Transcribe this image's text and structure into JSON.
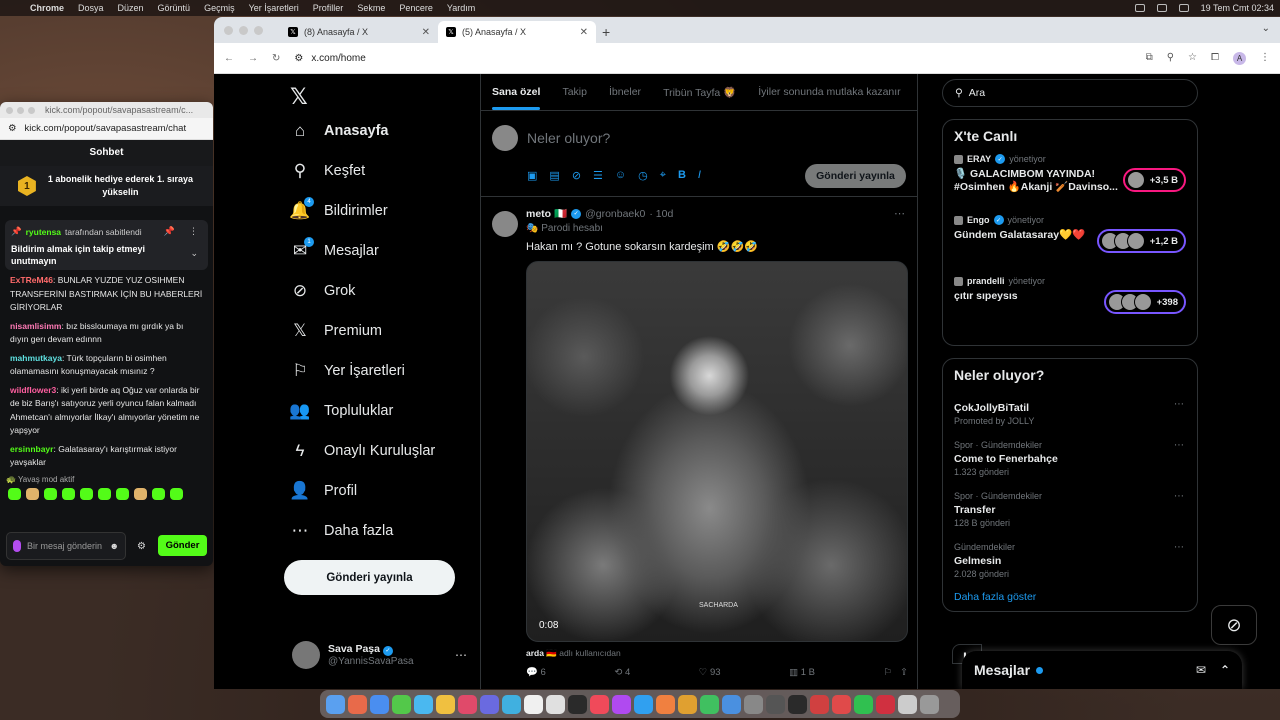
{
  "menubar": {
    "app": "Chrome",
    "items": [
      "Dosya",
      "Düzen",
      "Görüntü",
      "Geçmiş",
      "Yer İşaretleri",
      "Profiller",
      "Sekme",
      "Pencere",
      "Yardım"
    ],
    "clock": "19 Tem Cmt  02:34"
  },
  "browser": {
    "tabs": [
      {
        "title": "(8) Anasayfa / X"
      },
      {
        "title": "(5) Anasayfa / X"
      }
    ],
    "url": "x.com/home",
    "profile_initial": "A"
  },
  "x": {
    "nav": [
      {
        "label": "Anasayfa",
        "icon": "home-icon",
        "glyph": "⌂",
        "bold": true
      },
      {
        "label": "Keşfet",
        "icon": "search-icon",
        "glyph": "⚲"
      },
      {
        "label": "Bildirimler",
        "icon": "bell-icon",
        "glyph": "🔔",
        "badge": "4"
      },
      {
        "label": "Mesajlar",
        "icon": "mail-icon",
        "glyph": "✉",
        "badge": "1"
      },
      {
        "label": "Grok",
        "icon": "grok-icon",
        "glyph": "⊘"
      },
      {
        "label": "Premium",
        "icon": "x-premium-icon",
        "glyph": "𝕏"
      },
      {
        "label": "Yer İşaretleri",
        "icon": "bookmark-icon",
        "glyph": "⚐"
      },
      {
        "label": "Topluluklar",
        "icon": "communities-icon",
        "glyph": "👥"
      },
      {
        "label": "Onaylı Kuruluşlar",
        "icon": "lightning-icon",
        "glyph": "ϟ"
      },
      {
        "label": "Profil",
        "icon": "profile-icon",
        "glyph": "👤"
      },
      {
        "label": "Daha fazla",
        "icon": "more-circle-icon",
        "glyph": "⋯"
      }
    ],
    "post_button": "Gönderi yayınla",
    "me": {
      "name": "Sava Paşa",
      "handle": "@YannisSavaPasa"
    },
    "timeline_tabs": [
      "Sana özel",
      "Takip",
      "İbneler",
      "Tribün Tayfa 🦁",
      "İyiler sonunda mutlaka kazanır"
    ],
    "compose": {
      "placeholder": "Neler oluyor?",
      "send": "Gönderi yayınla"
    },
    "tweet": {
      "name": "meto 🇮🇹",
      "handle": "@gronbaek0",
      "time": "· 10d",
      "parody": "Parodi hesabı",
      "text": "Hakan mı ? Gotune sokarsın kardeşim 🤣🤣🤣",
      "video_time": "0:08",
      "watermark": "SACHARDA",
      "credit_name": "arda 🇩🇪",
      "credit_suffix": "adlı kullanıcıdan",
      "replies": "6",
      "reposts": "4",
      "likes": "93",
      "views": "1 B"
    },
    "search_placeholder": "Ara",
    "live": {
      "title": "X'te Canlı",
      "items": [
        {
          "host": "ERAY",
          "role": "yönetiyor",
          "title": "🎙️ GALACIMBOM YAYINDA! #Osimhen 🔥Akanji 🏏Davinso...",
          "count": "+3,5 B"
        },
        {
          "host": "Engo",
          "role": "yönetiyor",
          "title": "Gündem Galatasaray💛❤️",
          "count": "+1,2 B"
        },
        {
          "host": "prandelli",
          "role": "yönetiyor",
          "title": "çıtır sıpeysıs",
          "count": "+398"
        }
      ]
    },
    "trends": {
      "title": "Neler oluyor?",
      "items": [
        {
          "name": "ÇokJollyBiTatil",
          "meta": "Promoted by JOLLY",
          "cat": ""
        },
        {
          "cat": "Spor · Gündemdekiler",
          "name": "Come to Fenerbahçe",
          "meta": "1.323 gönderi"
        },
        {
          "cat": "Spor · Gündemdekiler",
          "name": "Transfer",
          "meta": "128 B gönderi"
        },
        {
          "cat": "Gündemdekiler",
          "name": "Gelmesin",
          "meta": "2.028 gönderi"
        }
      ],
      "show_more": "Daha fazla göster"
    },
    "messages_bar": "Mesajlar",
    "next_card_peek": "Ki"
  },
  "kick": {
    "title": "kick.com/popout/savapasastream/c...",
    "url": "kick.com/popout/savapasastream/chat",
    "header": "Sohbet",
    "gift_rank": "1",
    "gift_text": "1 abonelik hediye ederek 1. sıraya yükselin",
    "pinned_user": "ryutensa",
    "pinned_by": "tarafından sabitlendi",
    "pinned_text": "Bildirim almak için takip etmeyi unutmayın",
    "messages": [
      {
        "user": "ExTReM46",
        "color": "#ff6b6b",
        "text": "BUNLAR YUZDE YUZ OSIHMEN TRANSFERİNİ BASTIRMAK İÇİN BU HABERLERİ GİRİYORLAR"
      },
      {
        "user": "nisamlisimm",
        "color": "#ff7ab6",
        "text": "bız bissloumaya mı gırdık ya bı dıyın gerı devam edınnn"
      },
      {
        "user": "mahmutkaya",
        "color": "#5ee0e0",
        "text": "Türk topçuların bi osimhen olamamasını konuşmayacak mısınız ?"
      },
      {
        "user": "wildflower3",
        "color": "#ff5fa0",
        "text": "iki yerli birde aq Oğuz var onlarda bir de biz Barış'ı satıyoruz yerli oyuncu falan kalmadı Ahmetcan'ı almıyorlar İlkay'ı almıyorlar yönetim ne yapşyor"
      },
      {
        "user": "ersinnbayr",
        "color": "#53fc18",
        "text": "Galatasaray'ı karıştırmak istiyor yavşaklar"
      }
    ],
    "slow_mode": "Yavaş mod aktif",
    "input_placeholder": "Bir mesaj gönderin",
    "send": "Gönder"
  },
  "colors": {
    "accent": "#1d9bf0",
    "kick_green": "#53fc18"
  }
}
